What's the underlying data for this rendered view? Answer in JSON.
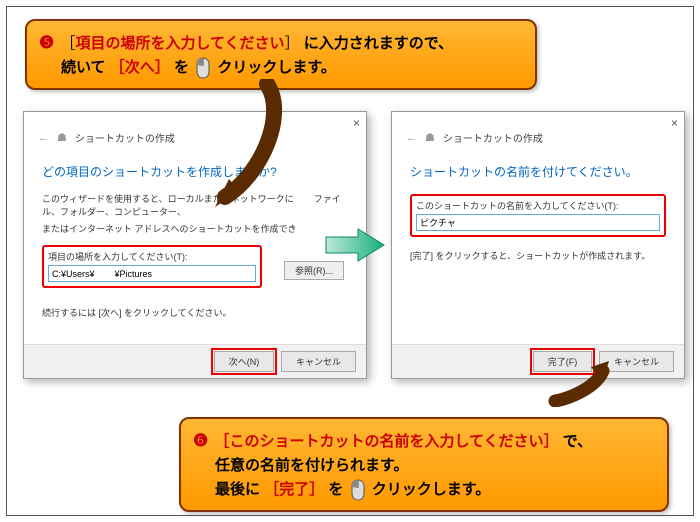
{
  "callout1": {
    "step": "❺",
    "text_a": "［",
    "bracket1": "項目の場所を入力してください",
    "text_b": "］",
    "text_c": "に入力されますので、",
    "line2a": "続いて",
    "line2_open": "［",
    "line2_label": "次へ",
    "line2_close": "］",
    "line2b": "を",
    "line2c": "クリックします。"
  },
  "callout2": {
    "step": "❻",
    "l1_open": "［",
    "l1_label": "このショートカットの名前を入力してください",
    "l1_close": "］",
    "l1_tail": "で、",
    "l2": "任意の名前を付けられます。",
    "l3a": "最後に",
    "l3_open": "［",
    "l3_label": "完了",
    "l3_close": "］",
    "l3b": "を",
    "l3c": "クリックします。"
  },
  "dlg1": {
    "header": "ショートカットの作成",
    "title": "どの項目のショートカットを作成しますか?",
    "desc1": "このウィザードを使用すると、ローカルまたはネットワークに",
    "desc1b": "ファイル、フォルダー、コンピューター、",
    "desc2": "またはインターネット アドレスへのショートカットを作成でき",
    "field_label": "項目の場所を入力してください(T):",
    "field_value": "C:¥Users¥        ¥Pictures",
    "browse": "参照(R)...",
    "continue_text": "続行するには [次へ] をクリックしてください。",
    "next": "次へ(N)",
    "cancel": "キャンセル"
  },
  "dlg2": {
    "header": "ショートカットの作成",
    "title": "ショートカットの名前を付けてください。",
    "field_label": "このショートカットの名前を入力してください(T):",
    "field_value": "ピクチャ",
    "finish_text": "[完了] をクリックすると、ショートカットが作成されます。",
    "finish": "完了(F)",
    "cancel": "キャンセル"
  }
}
